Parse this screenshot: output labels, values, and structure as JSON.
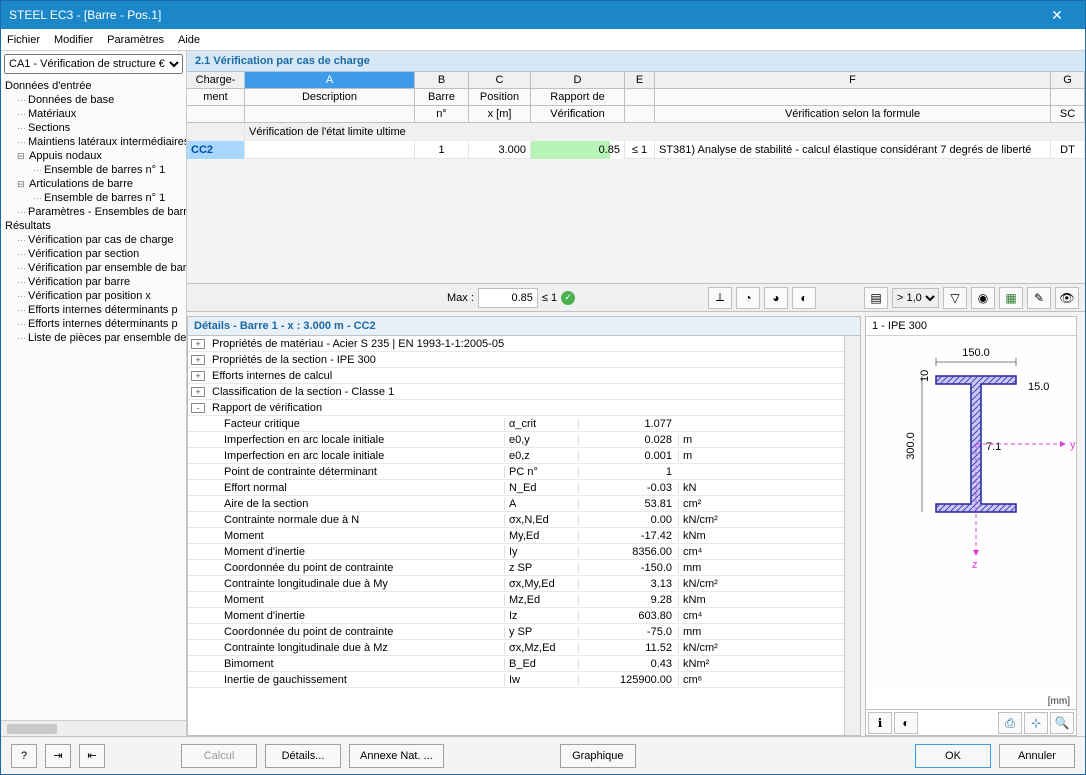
{
  "window": {
    "title": "STEEL EC3 - [Barre - Pos.1]"
  },
  "menu": [
    "Fichier",
    "Modifier",
    "Paramètres",
    "Aide"
  ],
  "sidebar": {
    "selector": "CA1 - Vérification de structure €",
    "nodes": [
      {
        "lvl": 0,
        "label": "Données d'entrée"
      },
      {
        "lvl": 1,
        "label": "Données de base"
      },
      {
        "lvl": 1,
        "label": "Matériaux"
      },
      {
        "lvl": 1,
        "label": "Sections"
      },
      {
        "lvl": 1,
        "label": "Maintiens latéraux intermédiaires"
      },
      {
        "lvl": 1,
        "label": "Appuis nodaux",
        "exp": true
      },
      {
        "lvl": 2,
        "label": "Ensemble de barres n° 1"
      },
      {
        "lvl": 1,
        "label": "Articulations de barre",
        "exp": true
      },
      {
        "lvl": 2,
        "label": "Ensemble de barres n° 1"
      },
      {
        "lvl": 1,
        "label": "Paramètres - Ensembles de barres"
      },
      {
        "lvl": 0,
        "label": "Résultats"
      },
      {
        "lvl": 1,
        "label": "Vérification par cas de charge"
      },
      {
        "lvl": 1,
        "label": "Vérification par section"
      },
      {
        "lvl": 1,
        "label": "Vérification par ensemble de barres"
      },
      {
        "lvl": 1,
        "label": "Vérification par barre"
      },
      {
        "lvl": 1,
        "label": "Vérification par position x"
      },
      {
        "lvl": 1,
        "label": "Efforts internes déterminants p"
      },
      {
        "lvl": 1,
        "label": "Efforts internes déterminants p"
      },
      {
        "lvl": 1,
        "label": "Liste de pièces  par ensemble de"
      }
    ]
  },
  "section": {
    "title": "2.1 Vérification par cas de charge"
  },
  "grid": {
    "row1": {
      "charge": "Charge-",
      "a": "A",
      "b": "B",
      "c": "C",
      "d": "D",
      "e": "E",
      "f": "F",
      "sc": "G"
    },
    "row2": {
      "charge": "ment",
      "a": "Description",
      "b": "Barre",
      "c": "Position",
      "d": "Rapport de",
      "e": "",
      "f": "",
      "sc": ""
    },
    "row3": {
      "charge": "",
      "a": "",
      "b": "n°",
      "c": "x [m]",
      "d": "Vérification",
      "e": "",
      "f": "Vérification selon la formule",
      "sc": "SC"
    },
    "section_row": "Vérification de l'état limite ultime",
    "data": {
      "cc": "CC2",
      "desc": "",
      "barre": "1",
      "pos": "3.000",
      "rapport": "0.85",
      "cond": "≤ 1",
      "formula": "ST381) Analyse de stabilité - calcul élastique considérant 7 degrés de liberté",
      "sc": "DT"
    },
    "toolbar": {
      "max_label": "Max :",
      "max_val": "0.85",
      "max_cond": "≤ 1",
      "ratio_sel": "> 1,0"
    }
  },
  "details": {
    "title": "Détails - Barre 1 - x : 3.000 m - CC2",
    "groups": [
      {
        "exp": "+",
        "label": "Propriétés de matériau - Acier S 235 | EN 1993-1-1:2005-05"
      },
      {
        "exp": "+",
        "label": "Propriétés de la section  -  IPE 300"
      },
      {
        "exp": "+",
        "label": "Efforts internes de calcul"
      },
      {
        "exp": "+",
        "label": "Classification de la section - Classe 1"
      },
      {
        "exp": "-",
        "label": "Rapport de vérification"
      }
    ],
    "rows": [
      {
        "label": "Facteur critique",
        "sym": "α_crit",
        "val": "1.077",
        "unit": ""
      },
      {
        "label": "Imperfection en arc locale initiale",
        "sym": "e0,y",
        "val": "0.028",
        "unit": "m"
      },
      {
        "label": "Imperfection en arc locale initiale",
        "sym": "e0,z",
        "val": "0.001",
        "unit": "m"
      },
      {
        "label": "Point de contrainte déterminant",
        "sym": "PC n°",
        "val": "1",
        "unit": ""
      },
      {
        "label": "Effort normal",
        "sym": "N_Ed",
        "val": "-0.03",
        "unit": "kN"
      },
      {
        "label": "Aire de la section",
        "sym": "A",
        "val": "53.81",
        "unit": "cm²"
      },
      {
        "label": "Contrainte normale due à N",
        "sym": "σx,N,Ed",
        "val": "0.00",
        "unit": "kN/cm²"
      },
      {
        "label": "Moment",
        "sym": "My,Ed",
        "val": "-17.42",
        "unit": "kNm"
      },
      {
        "label": "Moment d'inertie",
        "sym": "Iy",
        "val": "8356.00",
        "unit": "cm⁴"
      },
      {
        "label": "Coordonnée du point de contrainte",
        "sym": "z SP",
        "val": "-150.0",
        "unit": "mm"
      },
      {
        "label": "Contrainte longitudinale due à My",
        "sym": "σx,My,Ed",
        "val": "3.13",
        "unit": "kN/cm²"
      },
      {
        "label": "Moment",
        "sym": "Mz,Ed",
        "val": "9.28",
        "unit": "kNm"
      },
      {
        "label": "Moment d'inertie",
        "sym": "Iz",
        "val": "603.80",
        "unit": "cm⁴"
      },
      {
        "label": "Coordonnée du point de contrainte",
        "sym": "y SP",
        "val": "-75.0",
        "unit": "mm"
      },
      {
        "label": "Contrainte longitudinale due à Mz",
        "sym": "σx,Mz,Ed",
        "val": "11.52",
        "unit": "kN/cm²"
      },
      {
        "label": "Bimoment",
        "sym": "B_Ed",
        "val": "0.43",
        "unit": "kNm²"
      },
      {
        "label": "Inertie de gauchissement",
        "sym": "Iw",
        "val": "125900.00",
        "unit": "cm⁶"
      }
    ]
  },
  "preview": {
    "title": "1 - IPE 300",
    "unit": "[mm]",
    "dims": {
      "w": "150.0",
      "h": "300.0",
      "tf": "10",
      "tw": "7.1",
      "bf": "15.0"
    }
  },
  "footer": {
    "calcul": "Calcul",
    "details": "Détails...",
    "annexe": "Annexe Nat. ...",
    "graphique": "Graphique",
    "ok": "OK",
    "annuler": "Annuler"
  }
}
